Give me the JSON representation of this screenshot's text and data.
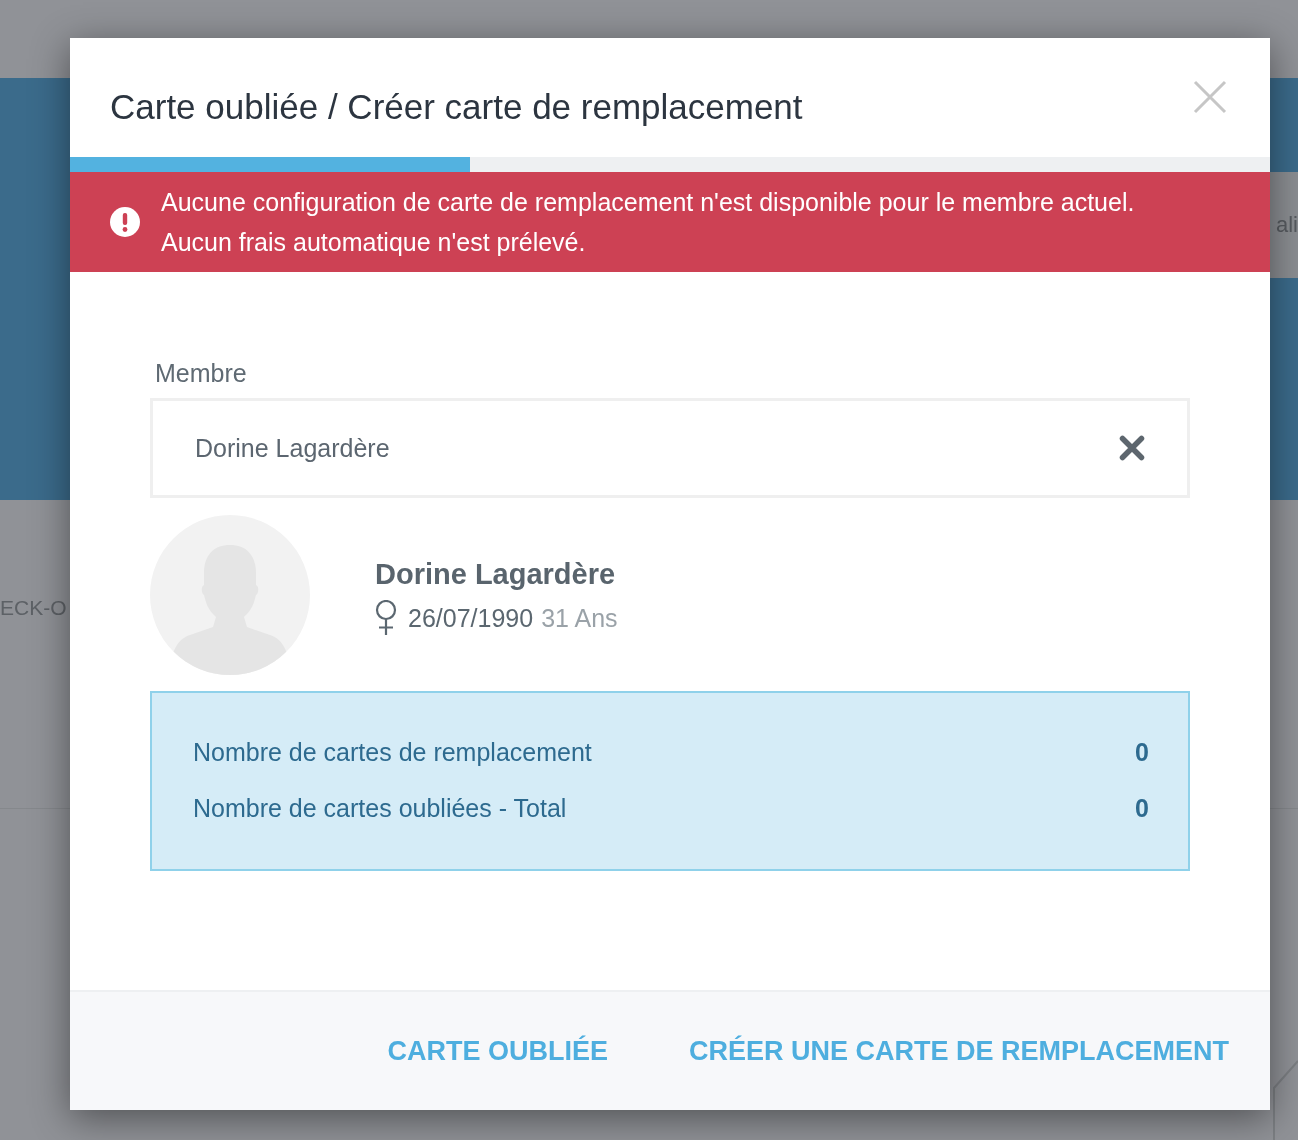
{
  "background": {
    "left_label": "ECK-O",
    "right_label": "ali"
  },
  "dialog": {
    "title": "Carte oubliée / Créer carte de remplacement",
    "progress": {
      "level": 0.333
    },
    "alert": {
      "messages": [
        "Aucune configuration de carte de remplacement n'est disponible pour le membre actuel.",
        "Aucun frais automatique n'est prélevé."
      ]
    },
    "member_field": {
      "label": "Membre",
      "value": "Dorine Lagardère"
    },
    "member": {
      "name": "Dorine Lagardère",
      "birth_date": "26/07/1990",
      "age": "31 Ans"
    },
    "stats": [
      {
        "label": "Nombre de cartes de remplacement",
        "value": "0"
      },
      {
        "label": "Nombre de cartes oubliées - Total",
        "value": "0"
      }
    ],
    "buttons": [
      {
        "label": "CARTE OUBLIÉE"
      },
      {
        "label": "CRÉER UNE CARTE DE REMPLACEMENT"
      }
    ]
  }
}
